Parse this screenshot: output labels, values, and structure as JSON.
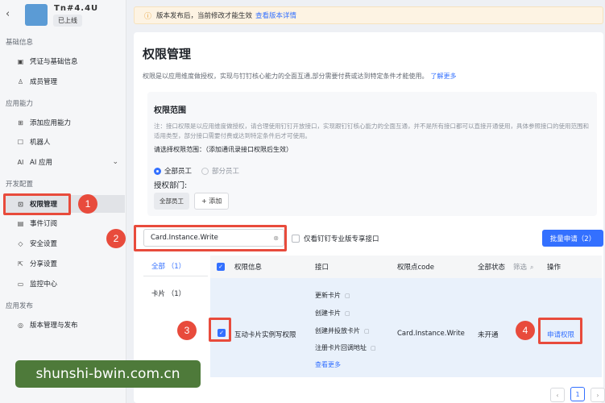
{
  "app": {
    "name": "Tn#4.4U",
    "status": "已上线"
  },
  "sidebar": {
    "groups": {
      "basic": "基础信息",
      "capability": "应用能力",
      "dev": "开发配置",
      "publish": "应用发布"
    },
    "items": [
      {
        "label": "凭证与基础信息",
        "icon": "certificate-icon"
      },
      {
        "label": "成员管理",
        "icon": "user-icon"
      },
      {
        "label": "添加应用能力",
        "icon": "grid-icon"
      },
      {
        "label": "机器人",
        "icon": "robot-icon"
      },
      {
        "label": "AI 应用",
        "icon": "ai-icon"
      },
      {
        "label": "权限管理",
        "icon": "lock-icon"
      },
      {
        "label": "事件订阅",
        "icon": "event-icon"
      },
      {
        "label": "安全设置",
        "icon": "shield-icon"
      },
      {
        "label": "分享设置",
        "icon": "share-icon"
      },
      {
        "label": "监控中心",
        "icon": "monitor-icon"
      },
      {
        "label": "版本管理与发布",
        "icon": "version-icon"
      }
    ]
  },
  "notice": {
    "text": "版本发布后，当前修改才能生效",
    "link": "查看版本详情"
  },
  "page": {
    "title": "权限管理",
    "desc": "权限是以应用维度做授权，实现与钉钉核心能力的全面互通,部分需要付费或达到特定条件才能使用。",
    "desc_link": "了解更多"
  },
  "scope": {
    "title": "权限范围",
    "note": "注：接口权限是以应用维度做授权，请合理使用钉钉开放接口，实现跟钉钉核心能力的全面互通，并不是所有接口都可以直接开通使用，具体参照接口的使用范围和适用类型，部分接口需要付费或达到特定条件后才可使用。",
    "prompt": "请选择权限范围：（添加通讯录接口权限后生效）",
    "radio_all": "全部员工",
    "radio_part": "部分员工",
    "dept_label": "授权部门:",
    "dept_tag": "全部员工",
    "add_label": "添加"
  },
  "search": {
    "value": "Card.Instance.Write"
  },
  "pro_only": "仅看钉钉专业版专享接口",
  "batch_button": "批量申请（2）",
  "tabs": {
    "all": "全部 （1）",
    "card": "卡片 （1）"
  },
  "table": {
    "headers": {
      "info": "权限信息",
      "iface": "接口",
      "code": "权限点code",
      "state": "全部状态",
      "filter": "筛选",
      "op": "操作"
    },
    "row": {
      "info": "互动卡片实例写权限",
      "interfaces": [
        "更新卡片",
        "创建卡片",
        "创建并投放卡片",
        "注册卡片回调地址"
      ],
      "see_more": "查看更多",
      "code": "Card.Instance.Write",
      "state": "未开通",
      "action": "申请权限"
    }
  },
  "pager": {
    "page": "1"
  },
  "markers": [
    "1",
    "2",
    "3",
    "4"
  ],
  "watermark": "shunshi-bwin.com.cn"
}
